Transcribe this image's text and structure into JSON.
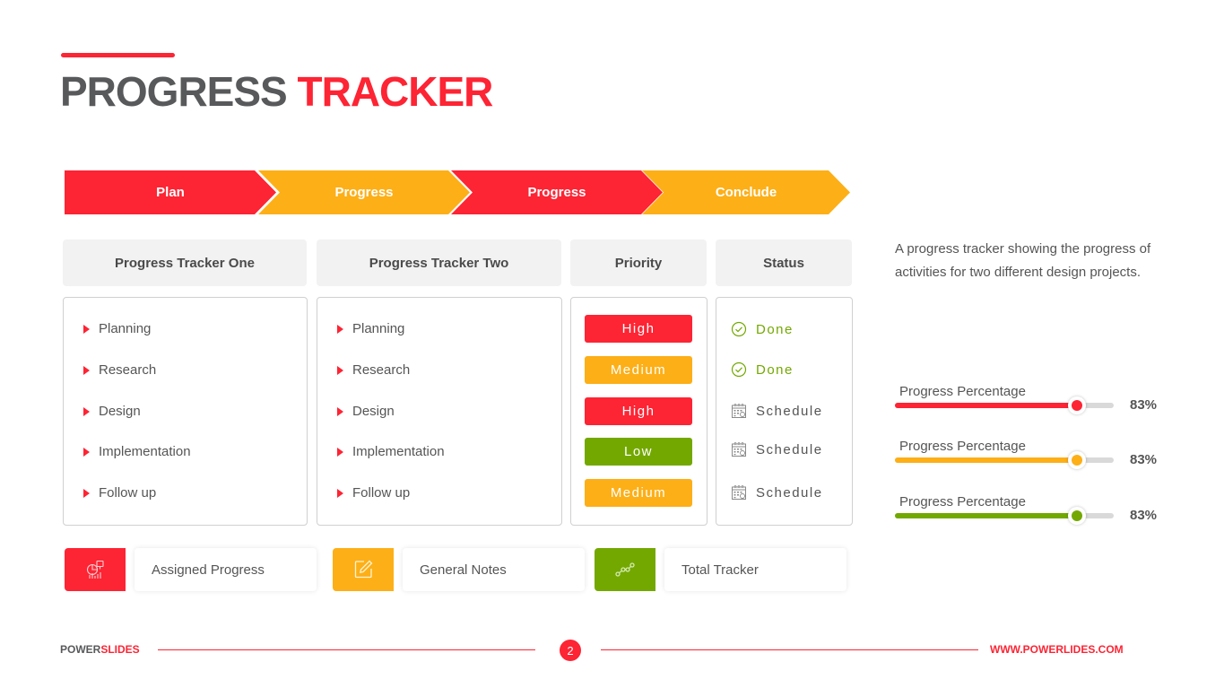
{
  "title": {
    "part1": "PROGRESS",
    "part2": "TRACKER"
  },
  "colors": {
    "red": "#fd2434",
    "orange": "#fdaf17",
    "green": "#73a800",
    "gray_text": "#58595b"
  },
  "stages": [
    {
      "label": "Plan",
      "color": "#fd2434"
    },
    {
      "label": "Progress",
      "color": "#fdaf17"
    },
    {
      "label": "Progress",
      "color": "#fd2434"
    },
    {
      "label": "Conclude",
      "color": "#fdaf17"
    }
  ],
  "columns": {
    "tracker_one": {
      "header": "Progress Tracker One",
      "items": [
        "Planning",
        "Research",
        "Design",
        "Implementation",
        "Follow up"
      ]
    },
    "tracker_two": {
      "header": "Progress Tracker Two",
      "items": [
        "Planning",
        "Research",
        "Design",
        "Implementation",
        "Follow up"
      ]
    },
    "priority": {
      "header": "Priority",
      "items": [
        {
          "label": "High",
          "color": "#fd2434"
        },
        {
          "label": "Medium",
          "color": "#fdaf17"
        },
        {
          "label": "High",
          "color": "#fd2434"
        },
        {
          "label": "Low",
          "color": "#73a800"
        },
        {
          "label": "Medium",
          "color": "#fdaf17"
        }
      ]
    },
    "status": {
      "header": "Status",
      "items": [
        {
          "label": "Done",
          "icon": "check-circle-icon",
          "color": "#73a800"
        },
        {
          "label": "Done",
          "icon": "check-circle-icon",
          "color": "#73a800"
        },
        {
          "label": "Schedule",
          "icon": "calendar-icon",
          "color": "#555555"
        },
        {
          "label": "Schedule",
          "icon": "calendar-icon",
          "color": "#555555"
        },
        {
          "label": "Schedule",
          "icon": "calendar-icon",
          "color": "#555555"
        }
      ]
    }
  },
  "description": "A progress tracker showing the progress of activities for two different design projects.",
  "progress_bars": [
    {
      "label": "Progress Percentage",
      "value": 83,
      "display": "83%",
      "color": "#fd2434"
    },
    {
      "label": "Progress Percentage",
      "value": 83,
      "display": "83%",
      "color": "#fdaf17"
    },
    {
      "label": "Progress Percentage",
      "value": 83,
      "display": "83%",
      "color": "#73a800"
    }
  ],
  "cards": [
    {
      "label": "Assigned Progress",
      "icon": "presentation-chart-icon",
      "color": "#fd2434"
    },
    {
      "label": "General Notes",
      "icon": "edit-note-icon",
      "color": "#fdaf17"
    },
    {
      "label": "Total Tracker",
      "icon": "trend-line-icon",
      "color": "#73a800"
    }
  ],
  "footer": {
    "brand_part1": "POWER",
    "brand_part2": "SLIDES",
    "page_number": "2",
    "url": "WWW.POWERLIDES.COM"
  }
}
